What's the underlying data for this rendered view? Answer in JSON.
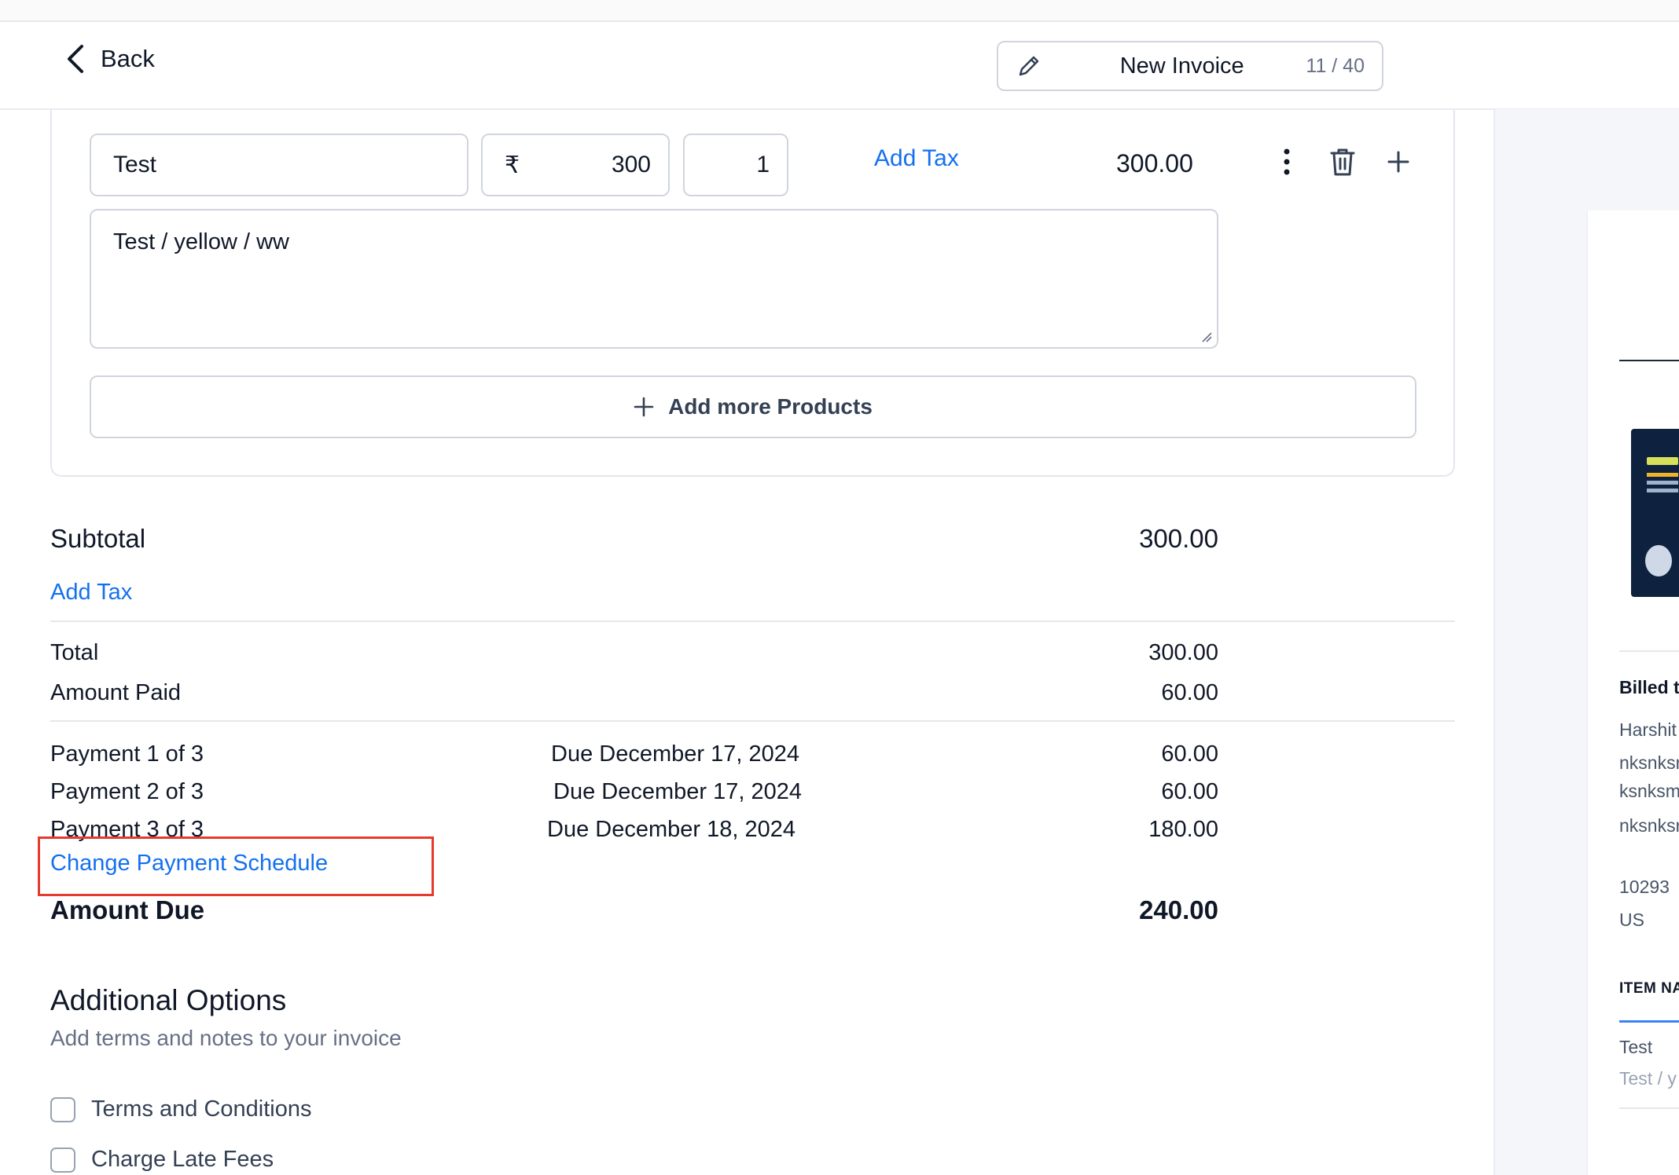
{
  "header": {
    "back_label": "Back",
    "invoice_title": "New Invoice",
    "char_count": "11 / 40"
  },
  "line_item": {
    "name": "Test",
    "currency_symbol": "₹",
    "price": "300",
    "quantity": "1",
    "add_tax_label": "Add Tax",
    "total": "300.00",
    "description": "Test / yellow / ww"
  },
  "add_more_label": "Add more Products",
  "summary": {
    "subtotal_label": "Subtotal",
    "subtotal_value": "300.00",
    "add_tax_label": "Add Tax",
    "total_label": "Total",
    "total_value": "300.00",
    "amount_paid_label": "Amount Paid",
    "amount_paid_value": "60.00",
    "payments": [
      {
        "label": "Payment 1 of 3",
        "due": "Due December 17, 2024",
        "amount": "60.00"
      },
      {
        "label": "Payment 2 of 3",
        "due": "Due December 17, 2024",
        "amount": "60.00"
      },
      {
        "label": "Payment 3 of 3",
        "due": "Due December 18, 2024",
        "amount": "180.00"
      }
    ],
    "change_schedule_label": "Change Payment Schedule",
    "amount_due_label": "Amount Due",
    "amount_due_value": "240.00"
  },
  "additional": {
    "title": "Additional Options",
    "subtitle": "Add terms and notes to your invoice",
    "options": [
      {
        "label": "Terms and Conditions",
        "checked": false
      },
      {
        "label": "Charge Late Fees",
        "checked": false
      }
    ]
  },
  "preview": {
    "billed_to_label": "Billed t",
    "name": "Harshit",
    "addr1": "nksnksr",
    "addr2": "ksnksm",
    "addr3": "nksnksr",
    "zip": "10293",
    "country": "US",
    "item_header": "ITEM NA",
    "item_name": "Test",
    "item_desc": "Test / y"
  },
  "colors": {
    "link": "#1570ef",
    "highlight_border": "#e63a2e",
    "border": "#d0d5dd"
  }
}
